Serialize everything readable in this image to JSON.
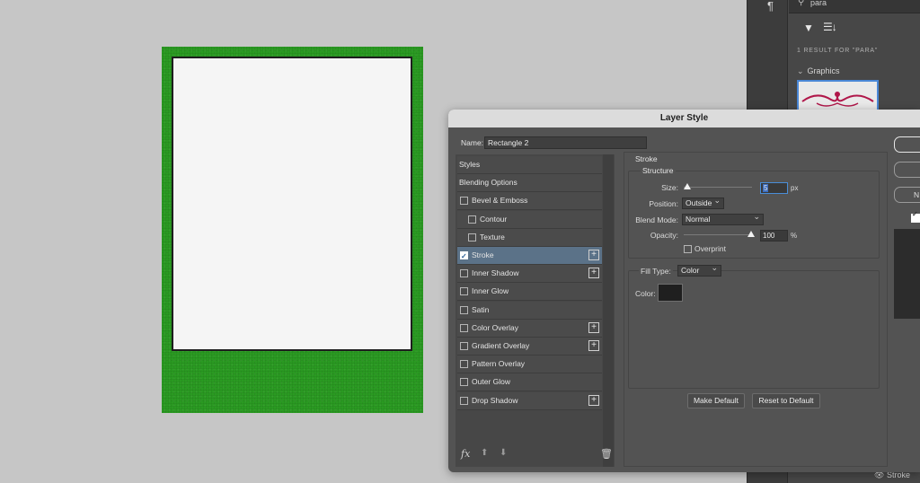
{
  "libraries": {
    "search_text": "para",
    "result_text": "1 RESULT FOR \"PARA\"",
    "section_label": "Graphics",
    "status_label": "Stroke"
  },
  "dialog": {
    "title": "Layer Style",
    "name_label": "Name:",
    "name_value": "Rectangle 2",
    "styles": [
      {
        "label": "Styles",
        "checkbox": false,
        "plus": false,
        "selected": false
      },
      {
        "label": "Blending Options",
        "checkbox": false,
        "plus": false,
        "selected": false
      },
      {
        "label": "Bevel & Emboss",
        "checkbox": true,
        "checked": false,
        "plus": false,
        "selected": false
      },
      {
        "label": "Contour",
        "checkbox": true,
        "checked": false,
        "plus": false,
        "selected": false
      },
      {
        "label": "Texture",
        "checkbox": true,
        "checked": false,
        "plus": false,
        "selected": false
      },
      {
        "label": "Stroke",
        "checkbox": true,
        "checked": true,
        "plus": true,
        "selected": true
      },
      {
        "label": "Inner Shadow",
        "checkbox": true,
        "checked": false,
        "plus": true,
        "selected": false
      },
      {
        "label": "Inner Glow",
        "checkbox": true,
        "checked": false,
        "plus": false,
        "selected": false
      },
      {
        "label": "Satin",
        "checkbox": true,
        "checked": false,
        "plus": false,
        "selected": false
      },
      {
        "label": "Color Overlay",
        "checkbox": true,
        "checked": false,
        "plus": true,
        "selected": false
      },
      {
        "label": "Gradient Overlay",
        "checkbox": true,
        "checked": false,
        "plus": true,
        "selected": false
      },
      {
        "label": "Pattern Overlay",
        "checkbox": true,
        "checked": false,
        "plus": false,
        "selected": false
      },
      {
        "label": "Outer Glow",
        "checkbox": true,
        "checked": false,
        "plus": false,
        "selected": false
      },
      {
        "label": "Drop Shadow",
        "checkbox": true,
        "checked": false,
        "plus": true,
        "selected": false
      }
    ],
    "stroke": {
      "section_title": "Stroke",
      "structure_title": "Structure",
      "size_label": "Size:",
      "size_value": "5",
      "size_unit": "px",
      "position_label": "Position:",
      "position_value": "Outside",
      "blend_label": "Blend Mode:",
      "blend_value": "Normal",
      "opacity_label": "Opacity:",
      "opacity_value": "100",
      "opacity_unit": "%",
      "overprint_label": "Overprint",
      "fill_type_label": "Fill Type:",
      "fill_type_value": "Color",
      "color_label": "Color:",
      "color_value": "#1f1f1f"
    },
    "buttons": {
      "make_default": "Make Default",
      "reset_default": "Reset to Default",
      "right_partial": "N"
    }
  },
  "colors": {
    "canvas_bg": "#c6c6c6",
    "doc_green": "#2a9a22",
    "selection_blue": "#5b7288"
  }
}
